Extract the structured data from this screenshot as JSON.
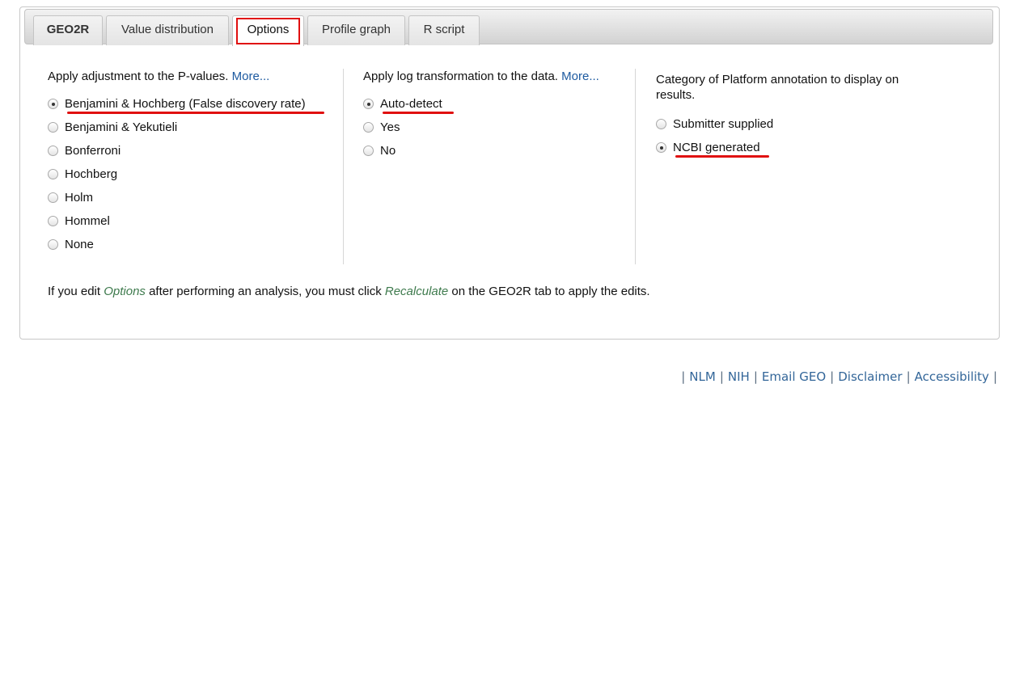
{
  "tabs": [
    {
      "label": "GEO2R",
      "bold": true
    },
    {
      "label": "Value distribution"
    },
    {
      "label": "Options",
      "active": true,
      "highlighted": true
    },
    {
      "label": "Profile graph"
    },
    {
      "label": "R script"
    }
  ],
  "pvalue": {
    "heading": "Apply adjustment to the P-values.",
    "more": "More...",
    "options": [
      "Benjamini & Hochberg (False discovery rate)",
      "Benjamini & Yekutieli",
      "Bonferroni",
      "Hochberg",
      "Holm",
      "Hommel",
      "None"
    ],
    "selected_index": 0
  },
  "logtransform": {
    "heading": "Apply log transformation to the data.",
    "more": "More...",
    "options": [
      "Auto-detect",
      "Yes",
      "No"
    ],
    "selected_index": 0
  },
  "annotation": {
    "heading": "Category of Platform annotation to display on results.",
    "options": [
      "Submitter supplied",
      "NCBI generated"
    ],
    "selected_index": 1
  },
  "note": {
    "before": "If you edit ",
    "options_word": "Options",
    "middle": " after performing an analysis, you must click ",
    "recalc_word": "Recalculate",
    "after": " on the GEO2R tab to apply the edits."
  },
  "footer": {
    "links": [
      "NLM",
      "NIH",
      "Email GEO",
      "Disclaimer",
      "Accessibility"
    ],
    "separator": "|"
  },
  "colors": {
    "highlight": "#e01010",
    "link": "#1d5aa0",
    "emphasis": "#3e7a4d"
  }
}
